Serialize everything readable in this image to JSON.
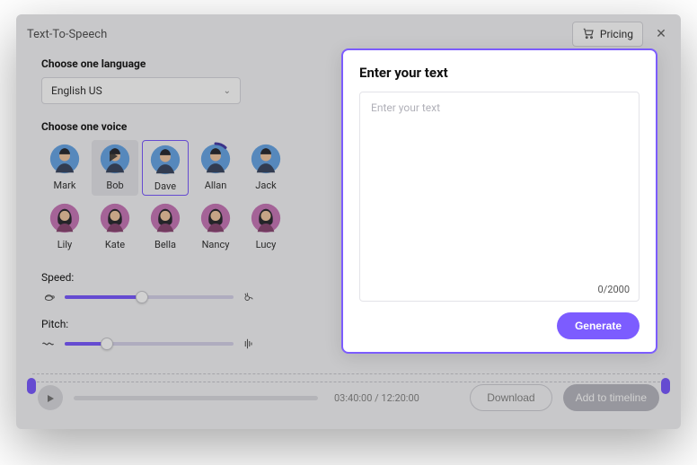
{
  "topbar": {
    "title": "Text-To-Speech",
    "pricing_label": "Pricing"
  },
  "language": {
    "label": "Choose one language",
    "selected": "English US"
  },
  "voice_section": {
    "label": "Choose one voice",
    "voices": [
      {
        "name": "Mark",
        "gender": "m",
        "state": "normal"
      },
      {
        "name": "Bob",
        "gender": "m",
        "state": "hover"
      },
      {
        "name": "Dave",
        "gender": "m",
        "state": "selected"
      },
      {
        "name": "Allan",
        "gender": "m",
        "state": "arc"
      },
      {
        "name": "Jack",
        "gender": "m",
        "state": "normal"
      },
      {
        "name": "Lily",
        "gender": "f",
        "state": "normal"
      },
      {
        "name": "Kate",
        "gender": "f",
        "state": "normal"
      },
      {
        "name": "Bella",
        "gender": "f",
        "state": "normal"
      },
      {
        "name": "Nancy",
        "gender": "f",
        "state": "normal"
      },
      {
        "name": "Lucy",
        "gender": "f",
        "state": "normal"
      }
    ]
  },
  "sliders": {
    "speed": {
      "label": "Speed:",
      "value_pct": 46
    },
    "pitch": {
      "label": "Pitch:",
      "value_pct": 25
    }
  },
  "footer": {
    "time_text": "03:40:00 / 12:20:00",
    "download_label": "Download",
    "add_label": "Add to timeline"
  },
  "modal": {
    "title": "Enter your text",
    "placeholder": "Enter your text",
    "counter": "0/2000",
    "generate_label": "Generate"
  },
  "colors": {
    "accent": "#7c5cff",
    "male_avatar": "#6aa7e6",
    "female_avatar": "#c879b9"
  }
}
